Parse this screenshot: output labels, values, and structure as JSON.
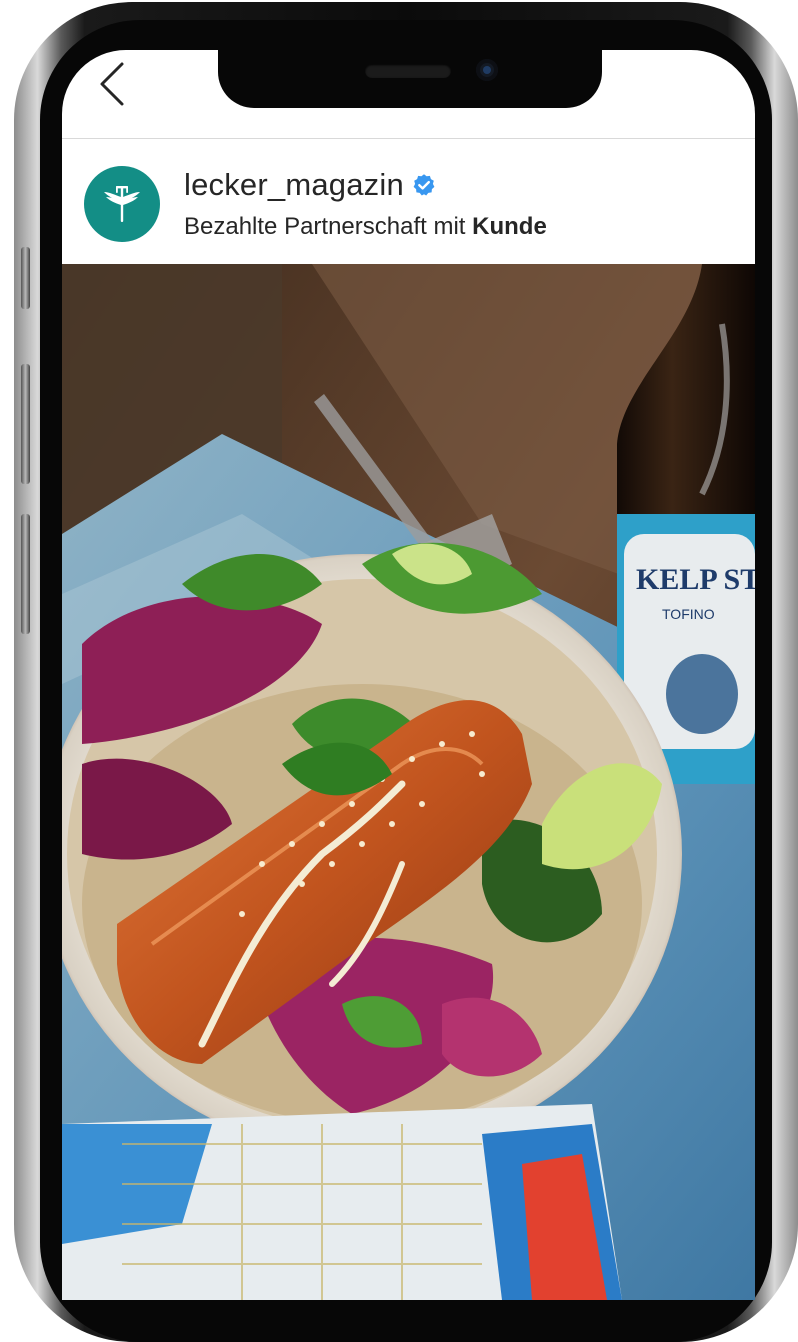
{
  "nav": {
    "back_icon": "chevron-left-icon"
  },
  "post": {
    "username": "lecker_magazin",
    "verified_icon": "verified-badge-icon",
    "sponsor_text": "Bezahlte Partnerschaft mit",
    "sponsor_name": "Kunde",
    "avatar_icon": "winged-fork-logo-icon"
  },
  "photo": {
    "bottle_label": "KELP STO",
    "bottle_sublabel": "TOFINO"
  },
  "colors": {
    "avatar_bg": "#138e86",
    "verified": "#3897f0",
    "text": "#262626"
  }
}
